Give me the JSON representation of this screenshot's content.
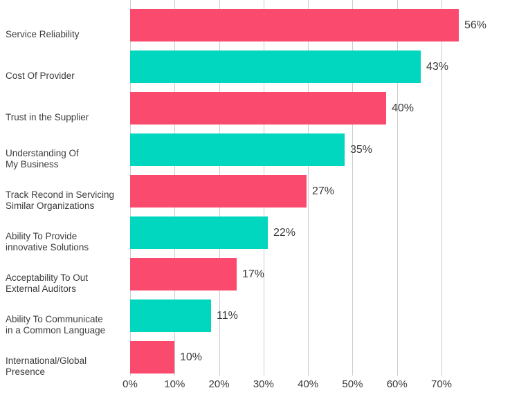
{
  "chart_data": {
    "type": "bar",
    "orientation": "horizontal",
    "title": "",
    "subtitle": "",
    "xlabel": "",
    "ylabel": "",
    "grid": true,
    "legend": false,
    "xlim": [
      0,
      70
    ],
    "x_ticks": [
      "0%",
      "10%",
      "20%",
      "30%",
      "40%",
      "50%",
      "60%",
      "70%"
    ],
    "x_tick_values": [
      0,
      10,
      20,
      30,
      40,
      50,
      60,
      70
    ],
    "categories": [
      "Service Reliability",
      "Cost Of Provider",
      "Trust in the Supplier",
      "Understanding Of\nMy Business",
      "Track Recond in Servicing\nSimilar Organizations",
      "Ability To Provide\ninnovative Solutions",
      "Acceptability To Out\nExternal Auditors",
      "Ability To Communicate\nin a Common Language",
      "International/Global\nPresence"
    ],
    "values": [
      56,
      43,
      40,
      35,
      27,
      22,
      17,
      11,
      10
    ],
    "value_labels": [
      "56%",
      "43%",
      "40%",
      "35%",
      "27%",
      "22%",
      "17%",
      "11%",
      "10%"
    ],
    "bar_extent_percent": [
      73.9,
      65.4,
      57.5,
      48.2,
      39.6,
      31.0,
      24.0,
      18.2,
      10.0
    ],
    "colors": [
      "#fa4b6e",
      "#00d7be",
      "#fa4b6e",
      "#00d7be",
      "#fa4b6e",
      "#00d7be",
      "#fa4b6e",
      "#00d7be",
      "#fa4b6e"
    ],
    "palette": {
      "pink": "#fa4b6e",
      "teal": "#00d7be",
      "gridline": "#cccccc",
      "text": "#3a3a3a",
      "category_text": "#3c3c3c",
      "background": "#ffffff"
    }
  }
}
